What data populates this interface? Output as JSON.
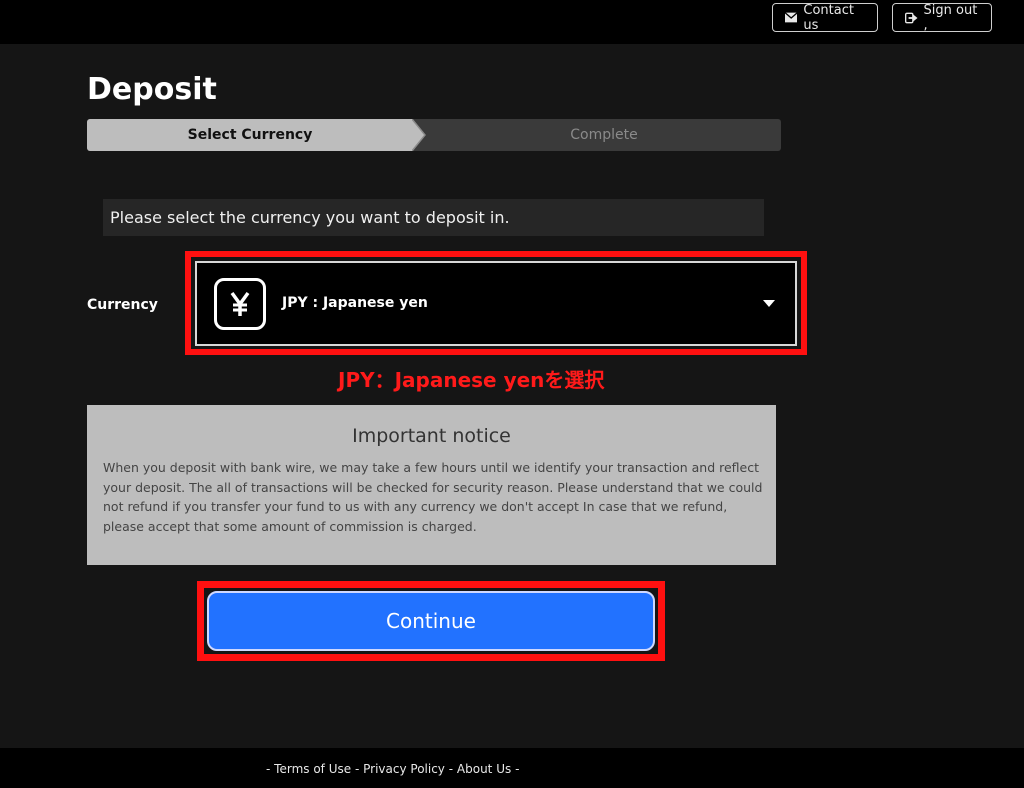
{
  "header": {
    "contact_label": "Contact us",
    "signout_label": "Sign out ,"
  },
  "page": {
    "title": "Deposit"
  },
  "steps": [
    {
      "label": "Select Currency",
      "active": true
    },
    {
      "label": "Complete",
      "active": false
    }
  ],
  "instruction": "Please select the currency you want to deposit in.",
  "currency": {
    "label": "Currency",
    "selected": "JPY : Japanese yen",
    "icon": "yen-icon"
  },
  "annotation": "JPY：Japanese yenを選択",
  "notice": {
    "title": "Important notice",
    "body": "When you deposit with bank wire, we may take a few hours until we identify your transaction and reflect your deposit. The all of transactions will be checked for security reason. Please understand that we could not refund if you transfer your fund to us with any currency we don't accept In case that we refund, please accept that some amount of commission is charged."
  },
  "continue_label": "Continue",
  "footer": {
    "dash": "-",
    "terms": "Terms of Use",
    "privacy": "Privacy Policy",
    "about": "About Us"
  },
  "colors": {
    "accent": "#2272ff",
    "highlight": "#ff1010",
    "background": "#151515"
  }
}
